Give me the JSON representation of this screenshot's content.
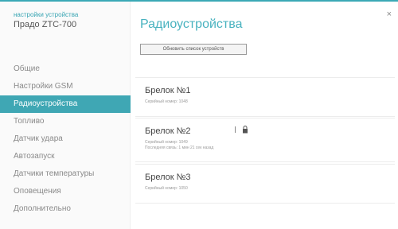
{
  "window": {
    "close_glyph": "×"
  },
  "sidebar": {
    "device_caption": "настройки устройства",
    "device_name": "Прадо ZTC-700",
    "items": [
      {
        "label": "Общие"
      },
      {
        "label": "Настройки GSM"
      },
      {
        "label": "Радиоустройства",
        "active": true
      },
      {
        "label": "Топливо"
      },
      {
        "label": "Датчик удара"
      },
      {
        "label": "Автозапуск"
      },
      {
        "label": "Датчики температуры"
      },
      {
        "label": "Оповещения"
      },
      {
        "label": "Дополнительно"
      }
    ]
  },
  "main": {
    "title": "Радиоустройства",
    "refresh_button": "Обновить список устройств",
    "devices": [
      {
        "title": "Брелок №1",
        "serial": "Серийный номер: 1048",
        "extra": ""
      },
      {
        "title": "Брелок №2",
        "serial": "Серийный номер: 1049",
        "extra": "Последняя связь: 1 мин 21 сек назад",
        "indicators": [
          "signal-bar-icon",
          "lock-icon"
        ]
      },
      {
        "title": "Брелок №3",
        "serial": "Серийный номер: 1050",
        "extra": ""
      }
    ]
  },
  "colors": {
    "accent": "#3fa7b4",
    "title": "#48b2bf"
  }
}
